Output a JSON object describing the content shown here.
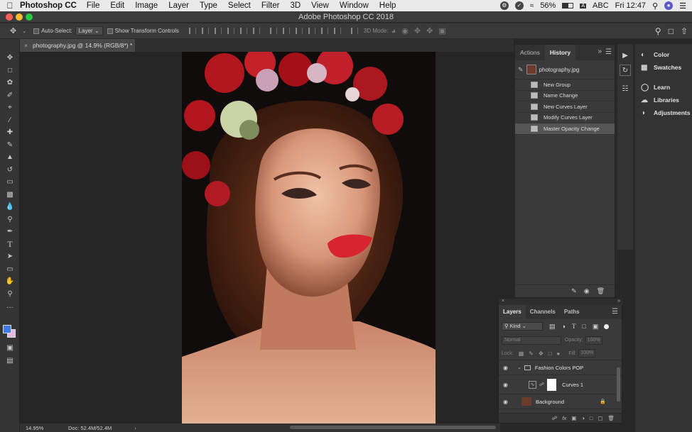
{
  "menubar": {
    "app_name": "Photoshop CC",
    "items": [
      "File",
      "Edit",
      "Image",
      "Layer",
      "Type",
      "Select",
      "Filter",
      "3D",
      "View",
      "Window",
      "Help"
    ],
    "battery": "56%",
    "input_source": "ABC",
    "clock": "Fri 12:47"
  },
  "window": {
    "title": "Adobe Photoshop CC 2018"
  },
  "options_bar": {
    "auto_select_label": "Auto-Select:",
    "auto_select_value": "Layer",
    "transform_label": "Show Transform Controls",
    "mode_3d_label": "3D Mode:"
  },
  "document": {
    "tab_title": "photography.jpg @ 14.9% (RGB/8*) *",
    "zoom": "14.95%",
    "doc_info": "Doc: 52.4M/52.4M"
  },
  "history_panel": {
    "tabs": [
      "Actions",
      "History"
    ],
    "active_tab": "History",
    "snapshot_name": "photography.jpg",
    "states": [
      "New Group",
      "Name Change",
      "New Curves Layer",
      "Modify Curves Layer",
      "Master Opacity Change"
    ],
    "selected_state": "Master Opacity Change"
  },
  "right_panels": {
    "items": [
      {
        "label": "Color",
        "icon": "color-wheel-icon"
      },
      {
        "label": "Swatches",
        "icon": "grid-icon"
      },
      {
        "label": "Learn",
        "icon": "lightbulb-icon"
      },
      {
        "label": "Libraries",
        "icon": "cloud-icon"
      },
      {
        "label": "Adjustments",
        "icon": "half-circle-icon"
      }
    ]
  },
  "layers_panel": {
    "tabs": [
      "Layers",
      "Channels",
      "Paths"
    ],
    "active_tab": "Layers",
    "filter_kind": "Kind",
    "blend_mode": "Normal",
    "opacity_label": "Opacity:",
    "opacity_value": "100%",
    "lock_label": "Lock:",
    "fill_label": "Fill:",
    "fill_value": "100%",
    "layers": [
      {
        "name": "Fashion Colors POP",
        "type": "group"
      },
      {
        "name": "Curves 1",
        "type": "adjustment"
      },
      {
        "name": "Background",
        "type": "pixel"
      }
    ]
  },
  "colors": {
    "foreground": "#3f79e4",
    "background": "#e3b8e6",
    "ui_dark": "#282828",
    "panel": "#3a3a3a"
  }
}
